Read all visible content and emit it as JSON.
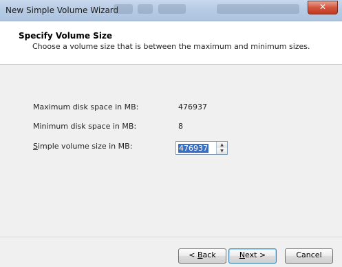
{
  "window": {
    "title": "New Simple Volume Wizard",
    "close_glyph": "✕"
  },
  "header": {
    "title": "Specify Volume Size",
    "subtitle": "Choose a volume size that is between the maximum and minimum sizes."
  },
  "fields": {
    "max_label": "Maximum disk space in MB:",
    "max_value": "476937",
    "min_label": "Minimum disk space in MB:",
    "min_value": "8",
    "size_label_prefix": "S",
    "size_label_rest": "imple volume size in MB:",
    "size_value": "476937"
  },
  "buttons": {
    "back_prefix": "< ",
    "back_accel": "B",
    "back_rest": "ack",
    "next_accel": "N",
    "next_rest": "ext >",
    "cancel": "Cancel"
  },
  "icons": {
    "close": "close-icon",
    "spin_up": "chevron-up-icon",
    "spin_down": "chevron-down-icon"
  }
}
